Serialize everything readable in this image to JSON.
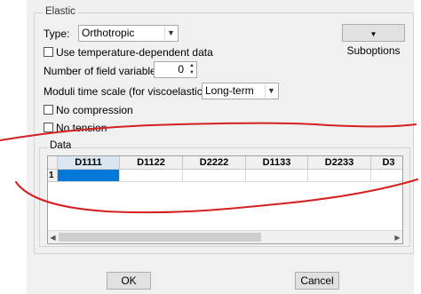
{
  "elastic": {
    "group_title": "Elastic",
    "type_label": "Type:",
    "type_value": "Orthotropic",
    "suboptions_label": "Suboptions",
    "temp_dependent_label": "Use temperature-dependent data",
    "field_vars_label": "Number of field variables:",
    "field_vars_value": "0",
    "moduli_label": "Moduli time scale (for viscoelasticity):",
    "moduli_value": "Long-term",
    "no_compression_label": "No compression",
    "no_tension_label": "No tension"
  },
  "data": {
    "group_title": "Data",
    "columns": [
      "D1111",
      "D1122",
      "D2222",
      "D1133",
      "D2233",
      "D3"
    ],
    "rows": [
      {
        "index": "1"
      }
    ]
  },
  "buttons": {
    "ok": "OK",
    "cancel": "Cancel"
  },
  "annotation": {
    "stroke_color": "#d42020"
  }
}
